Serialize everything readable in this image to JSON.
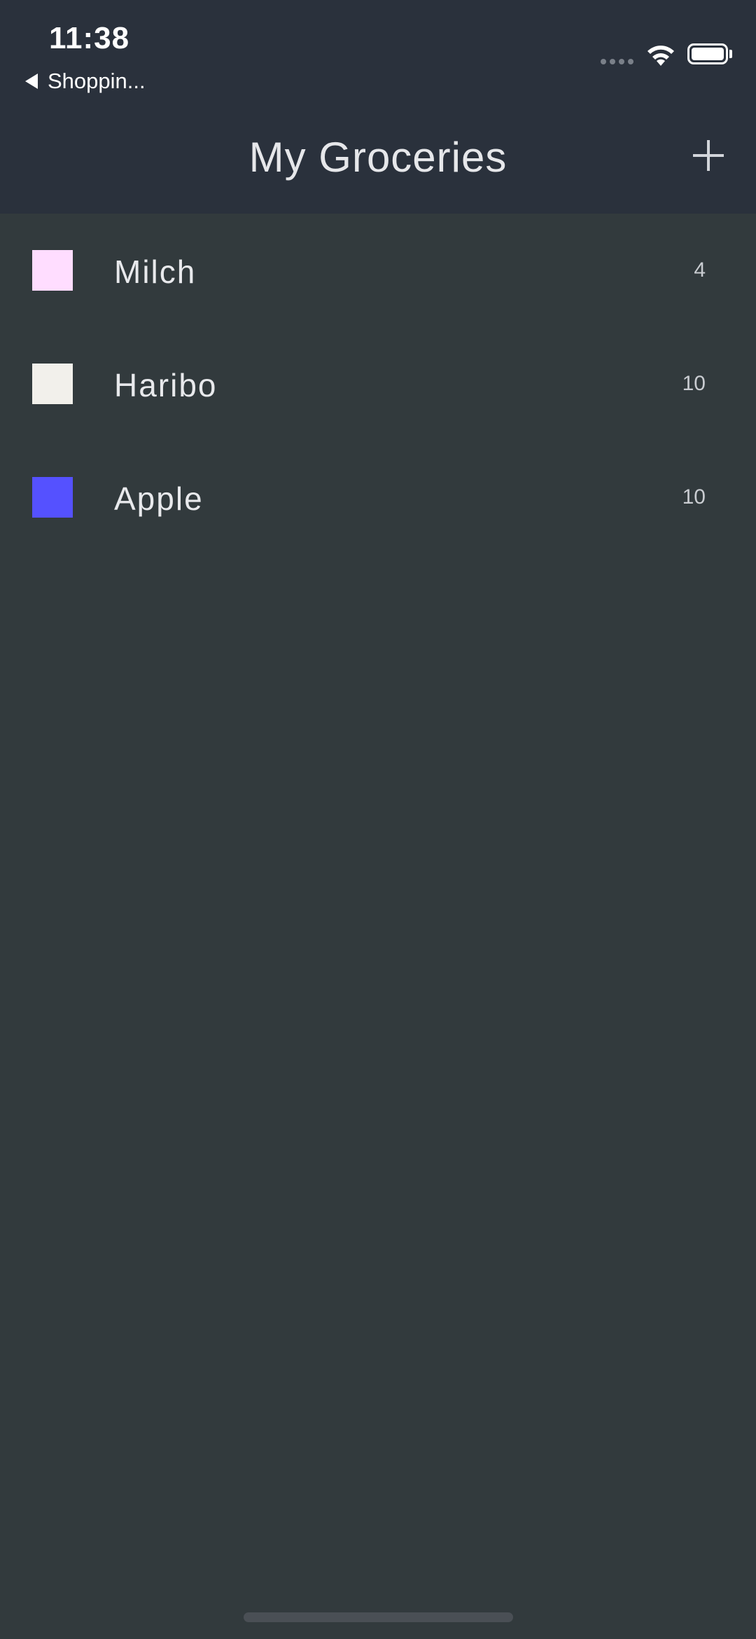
{
  "status_bar": {
    "time": "11:38",
    "back_app_label": "Shoppin..."
  },
  "header": {
    "title": "My Groceries",
    "add_icon": "plus-icon"
  },
  "groceries": [
    {
      "name": "Milch",
      "quantity": "4",
      "color": "#FFDDFF"
    },
    {
      "name": "Haribo",
      "quantity": "10",
      "color": "#F2F0EB"
    },
    {
      "name": "Apple",
      "quantity": "10",
      "color": "#5551FF"
    }
  ],
  "colors": {
    "header_bg": "#2A313C",
    "body_bg": "#323A3D",
    "text": "#E8E9EC"
  }
}
